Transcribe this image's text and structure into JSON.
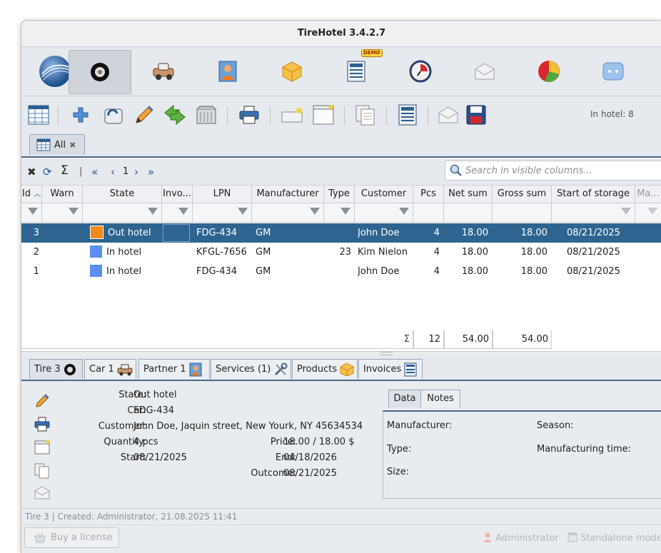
{
  "window": {
    "title": "TireHotel 3.4.2.7"
  },
  "nav": {
    "demo_badge": "DEMO",
    "items": [
      "app-logo",
      "tire",
      "car",
      "partner",
      "product",
      "document",
      "clock",
      "envelope",
      "chart",
      "more"
    ]
  },
  "toolbar": {
    "in_hotel": "In hotel: 8"
  },
  "tabs": {
    "all_label": "All",
    "close": "✖"
  },
  "gridtools": {
    "page": "1",
    "search_placeholder": "Search in visible columns..."
  },
  "columns": [
    "Id",
    "Warn",
    "State",
    "Invo...",
    "LPN",
    "Manufacturer",
    "Type",
    "Customer",
    "Pcs",
    "Net sum",
    "Gross sum",
    "Start of storage",
    "Ma..."
  ],
  "rows": [
    {
      "id": "3",
      "state": "Out hotel",
      "state_color": "#f28a1b",
      "lpn": "FDG-434",
      "manufacturer": "GM",
      "type": "",
      "customer": "John Doe",
      "pcs": "4",
      "net": "18.00",
      "gross": "18.00",
      "start": "08/21/2025"
    },
    {
      "id": "2",
      "state": "In hotel",
      "state_color": "#5b8ef0",
      "lpn": "KFGL-7656",
      "manufacturer": "GM",
      "type": "23",
      "customer": "Kim Nielon",
      "pcs": "4",
      "net": "18.00",
      "gross": "18.00",
      "start": "08/21/2025"
    },
    {
      "id": "1",
      "state": "In hotel",
      "state_color": "#5b8ef0",
      "lpn": "FDG-434",
      "manufacturer": "GM",
      "type": "",
      "customer": "John Doe",
      "pcs": "4",
      "net": "18.00",
      "gross": "18.00",
      "start": "08/21/2025"
    }
  ],
  "totals": {
    "sigma": "Σ",
    "pcs": "12",
    "net": "54.00",
    "gross": "54.00"
  },
  "subtabs": [
    "Tire 3",
    "Car 1",
    "Partner 1",
    "Services (1)",
    "Products",
    "Invoices"
  ],
  "detail": {
    "state_label": "State:",
    "state": "Out hotel",
    "car_label": "Car:",
    "car": "FDG-434",
    "customer_label": "Customer:",
    "customer": "John Doe, Jaquin street, New Yourk, NY 45634534",
    "quantity_label": "Quantity:",
    "quantity": "4 pcs",
    "start_label": "Start:",
    "start": "08/21/2025",
    "price_label": "Price:",
    "price": "18.00 / 18.00 $",
    "end_label": "End:",
    "end": "04/18/2026",
    "outcome_label": "Outcome:",
    "outcome": "08/21/2025"
  },
  "datatabs": [
    "Data",
    "Notes"
  ],
  "datapanel": {
    "manufacturer": "Manufacturer:",
    "season": "Season:",
    "type": "Type:",
    "mtime": "Manufacturing time:",
    "size": "Size:"
  },
  "status": "Tire 3 | Created: Administrator, 21.08.2025 11:41",
  "bottom": {
    "buy": "Buy a license",
    "user": "Administrator",
    "mode": "Standalone mode"
  }
}
